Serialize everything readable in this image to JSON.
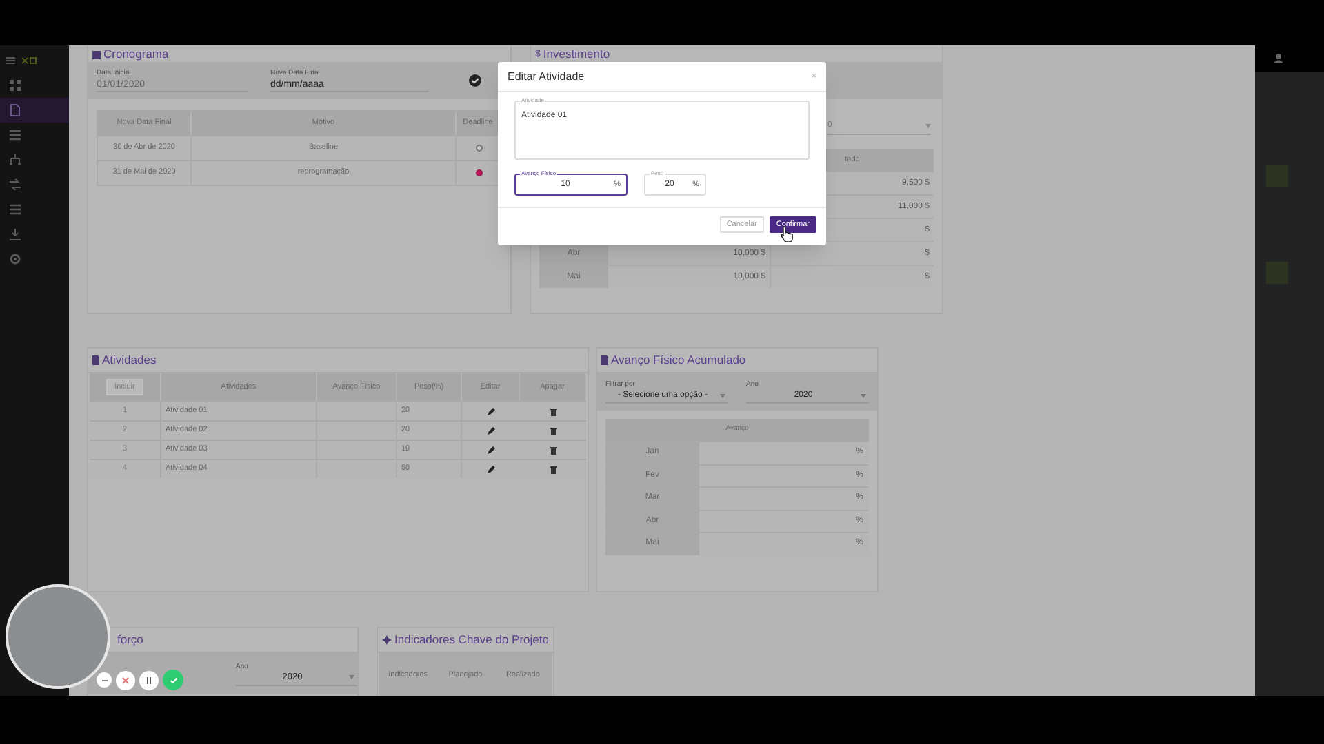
{
  "sidebar": {
    "items": [
      {
        "kind": "grid",
        "selected": false
      },
      {
        "kind": "file",
        "selected": true
      },
      {
        "kind": "list",
        "selected": false
      },
      {
        "kind": "network",
        "selected": false
      },
      {
        "kind": "arrows",
        "selected": false
      },
      {
        "kind": "list",
        "selected": false
      },
      {
        "kind": "download",
        "selected": false
      },
      {
        "kind": "gear",
        "selected": false
      }
    ]
  },
  "cronograma": {
    "title": "Cronograma",
    "fields": [
      {
        "label": "Data Inicial",
        "value": "01/01/2020",
        "disabled": true
      },
      {
        "label": "Nova Data Final",
        "placeholder": "dd/mm/aaaa",
        "disabled": false
      }
    ],
    "table": {
      "columns": [
        "Nova Data Final",
        "Motivo",
        "Deadline"
      ],
      "rows": [
        {
          "date": "30 de Abr de 2020",
          "reason": "Baseline",
          "selected": false
        },
        {
          "date": "31 de Mai de 2020",
          "reason": "reprogramação",
          "selected": true
        }
      ]
    }
  },
  "investimento": {
    "icon": "$",
    "title": "Investimento",
    "select": {
      "value": "0"
    },
    "table": {
      "column_3": "tado",
      "rows": [
        {
          "column_3": "9,500 $"
        },
        {
          "column_3": "11,000 $"
        },
        {
          "column_3": "$"
        },
        {
          "month": "Abr",
          "column_2": "10,000 $",
          "column_3": "$"
        },
        {
          "month": "Mai",
          "column_2": "10,000 $",
          "column_3": "$"
        }
      ]
    }
  },
  "atividades": {
    "title": "Atividades",
    "add_button": "Incluir",
    "columns": [
      "Atividades",
      "Avanço Físico",
      "Peso(%)",
      "Editar",
      "Apagar"
    ],
    "rows": [
      {
        "number": "1",
        "name": "Atividade 01",
        "weight": "20"
      },
      {
        "number": "2",
        "name": "Atividade 02",
        "weight": "20"
      },
      {
        "number": "3",
        "name": "Atividade 03",
        "weight": "10"
      },
      {
        "number": "4",
        "name": "Atividade 04",
        "weight": "50"
      }
    ]
  },
  "avanco": {
    "title": "Avanço Físico Acumulado",
    "filters": [
      {
        "label": "Filtrar por",
        "value": "- Selecione uma opção -"
      },
      {
        "label": "Ano",
        "value": "2020"
      }
    ],
    "table": {
      "column": "Avanço",
      "rows": [
        {
          "month": "Jan",
          "unit": "%"
        },
        {
          "month": "Fev",
          "unit": "%"
        },
        {
          "month": "Mar",
          "unit": "%"
        },
        {
          "month": "Abr",
          "unit": "%"
        },
        {
          "month": "Mai",
          "unit": "%"
        }
      ]
    }
  },
  "esforco": {
    "title": "forço",
    "filters": [
      {
        "label": "Ano",
        "value": "2020"
      }
    ]
  },
  "indicadores": {
    "title": "Indicadores Chave do Projeto",
    "columns": [
      "Indicadores",
      "Planejado",
      "Realizado"
    ]
  },
  "modal": {
    "title": "Editar Atividade",
    "close": "×",
    "activity": {
      "label": "Atividade",
      "value": "Atividade 01"
    },
    "fields": [
      {
        "label": "Avanço Físico",
        "value": "10",
        "unit": "%",
        "focused": true
      },
      {
        "label": "Peso",
        "value": "20",
        "unit": "%",
        "focused": false
      }
    ],
    "buttons": [
      {
        "label": "Cancelar",
        "kind": "secondary"
      },
      {
        "label": "Confirmar",
        "kind": "primary"
      }
    ]
  },
  "webcam": {
    "controls": [
      {
        "kind": "minus"
      },
      {
        "kind": "close"
      },
      {
        "kind": "pause"
      },
      {
        "kind": "check"
      }
    ]
  }
}
